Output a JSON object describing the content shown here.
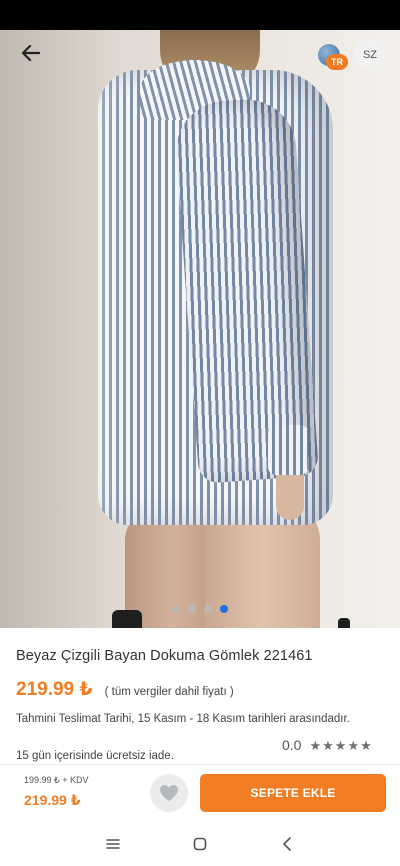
{
  "header": {
    "back_icon": "arrow-left-icon",
    "language_badge": "TR",
    "size_label": "SZ"
  },
  "gallery": {
    "image_count": 4,
    "active_index": 3
  },
  "product": {
    "title": "Beyaz Çizgili Bayan Dokuma Gömlek 221461",
    "price": "219.99 ₺",
    "vat_note": "( tüm vergiler dahil fiyatı )",
    "delivery_note": "Tahmini Teslimat Tarihi, 15 Kasım - 18 Kasım tarihleri arasındadır.",
    "return_note": "15 gün içerisinde ücretsiz iade.",
    "rating_value": "0.0",
    "stars": 5
  },
  "bottom_bar": {
    "net_price": "199.99 ₺ + KDV",
    "price": "219.99 ₺",
    "favorite_icon": "heart-icon",
    "add_to_cart_label": "SEPETE EKLE"
  },
  "colors": {
    "accent": "#f07d24",
    "active_dot": "#1e6fe8"
  }
}
